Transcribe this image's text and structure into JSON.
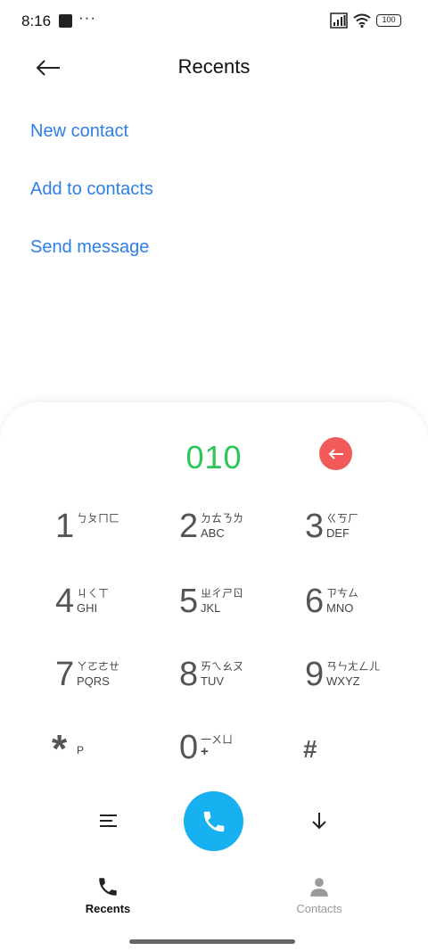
{
  "status_bar": {
    "time": "8:16",
    "dots": "···",
    "battery": "100"
  },
  "header": {
    "title": "Recents"
  },
  "options": [
    {
      "label": "New contact"
    },
    {
      "label": "Add to contacts"
    },
    {
      "label": "Send message"
    }
  ],
  "dialer": {
    "number": "010",
    "keys": [
      {
        "digit": "1",
        "zhuyin": "ㄅㄆㄇㄈ",
        "letters": ""
      },
      {
        "digit": "2",
        "zhuyin": "ㄉㄊㄋㄌ",
        "letters": "ABC"
      },
      {
        "digit": "3",
        "zhuyin": "ㄍㄎㄏ",
        "letters": "DEF"
      },
      {
        "digit": "4",
        "zhuyin": "ㄐㄑㄒ",
        "letters": "GHI"
      },
      {
        "digit": "5",
        "zhuyin": "ㄓㄔㄕㄖ",
        "letters": "JKL"
      },
      {
        "digit": "6",
        "zhuyin": "ㄗㄘㄙ",
        "letters": "MNO"
      },
      {
        "digit": "7",
        "zhuyin": "ㄚㄛㄜㄝ",
        "letters": "PQRS"
      },
      {
        "digit": "8",
        "zhuyin": "ㄞㄟㄠㄡ",
        "letters": "TUV"
      },
      {
        "digit": "9",
        "zhuyin": "ㄢㄣㄤㄥㄦ",
        "letters": "WXYZ"
      },
      {
        "digit": "*",
        "zhuyin": "",
        "letters": "P"
      },
      {
        "digit": "0",
        "zhuyin": "一ㄨㄩ",
        "letters": "+"
      },
      {
        "digit": "#",
        "zhuyin": "",
        "letters": ""
      }
    ]
  },
  "bottom_nav": {
    "recents": "Recents",
    "contacts": "Contacts"
  },
  "colors": {
    "link": "#2d7fe8",
    "number": "#2ec45a",
    "backspace": "#f25a5a",
    "call": "#17b0f0"
  }
}
